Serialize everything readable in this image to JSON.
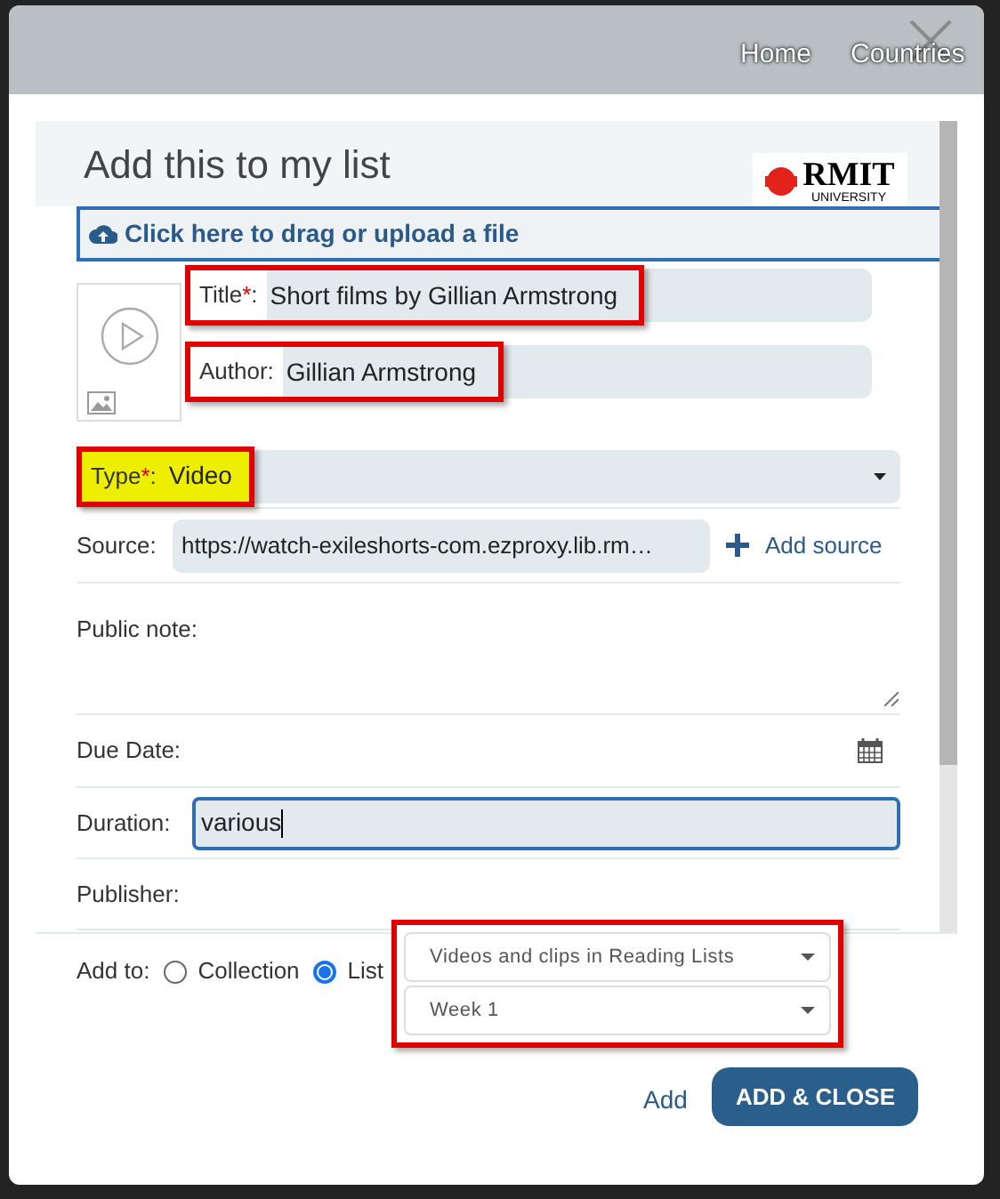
{
  "nav": [
    {
      "label": "Home"
    },
    {
      "label": "Countries"
    }
  ],
  "title": "Add this to my list",
  "logo": {
    "name": "RMIT",
    "subtitle": "UNIVERSITY"
  },
  "upload": {
    "label": "Click here to drag or upload a file"
  },
  "main_fields": [
    {
      "label": "Title",
      "required_mark": "*",
      "colon": ":",
      "value": "Short films by Gillian Armstrong",
      "annotated": true
    },
    {
      "label": "Author:",
      "value": "Gillian Armstrong",
      "annotated": true
    }
  ],
  "fields": [
    {
      "kind": "select",
      "label": "Type",
      "required_mark": "*",
      "colon": ":",
      "value": "Video",
      "annotated": true,
      "highlighted": true
    },
    {
      "kind": "source",
      "label": "Source:",
      "value": "https://watch-exileshorts-com.ezproxy.lib.rm…",
      "action": "Add source"
    },
    {
      "kind": "textarea",
      "label": "Public note:"
    },
    {
      "kind": "date",
      "label": "Due Date:"
    },
    {
      "kind": "text",
      "label": "Duration:",
      "value": "various",
      "focused": true
    },
    {
      "kind": "text",
      "label": "Publisher:"
    }
  ],
  "add_to": {
    "label": "Add to:",
    "options": [
      {
        "label": "Collection",
        "selected": false
      },
      {
        "label": "List",
        "selected": true
      }
    ],
    "selects": [
      {
        "value": "Videos and clips in Reading Lists"
      },
      {
        "value": "Week 1"
      }
    ],
    "annotated": true
  },
  "buttons": [
    {
      "kind": "link",
      "label": "Add"
    },
    {
      "kind": "primary",
      "label": "ADD & CLOSE"
    }
  ]
}
